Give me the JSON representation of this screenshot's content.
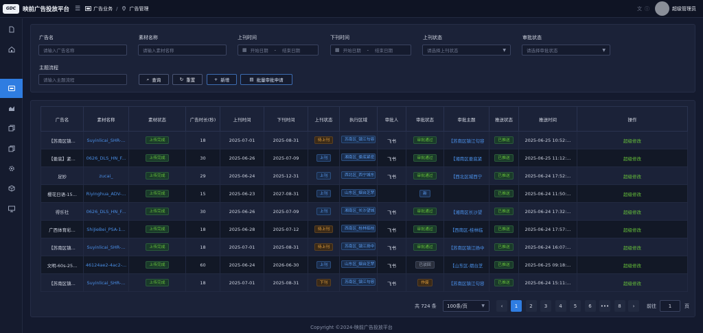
{
  "app": {
    "logo_text": "GDC",
    "title": "映前广告投放平台",
    "breadcrumb": [
      "广告业务",
      "广告管理"
    ],
    "user": "超级管理员"
  },
  "sidebar": {
    "items": [
      {
        "icon": "document-icon",
        "active": false
      },
      {
        "icon": "home-icon",
        "active": false
      },
      {
        "icon": "ad-icon",
        "active": true
      },
      {
        "icon": "chart-icon",
        "active": false
      },
      {
        "icon": "copy-icon",
        "active": false
      },
      {
        "icon": "copy-icon",
        "active": false
      },
      {
        "icon": "gear-icon",
        "active": false
      },
      {
        "icon": "cube-icon",
        "active": false
      },
      {
        "icon": "monitor-icon",
        "active": false
      }
    ]
  },
  "filters": {
    "ad_name": {
      "label": "广告名",
      "placeholder": "请输入广告名称"
    },
    "material_name": {
      "label": "素材名称",
      "placeholder": "请输入素材名称"
    },
    "online_time": {
      "label": "上刊时间",
      "start": "开始日期",
      "sep": "-",
      "end": "结束日期"
    },
    "offline_time": {
      "label": "下刊时间",
      "start": "开始日期",
      "sep": "-",
      "end": "结束日期"
    },
    "online_status": {
      "label": "上刊状态",
      "placeholder": "请选择上刊状态"
    },
    "audit_status": {
      "label": "审批状态",
      "placeholder": "请选择审批状态"
    },
    "subject_flow": {
      "label": "主题流程",
      "placeholder": "请输入主题流程"
    },
    "buttons": {
      "query": "查询",
      "reset": "重置",
      "add": "新增",
      "batch": "批量审批申请"
    }
  },
  "table": {
    "headers": [
      "广告名",
      "素材名称",
      "素材状态",
      "广告时长(秒)",
      "上刊时间",
      "下刊时间",
      "上刊状态",
      "执行区域",
      "审批人",
      "审批状态",
      "审批主题",
      "推送状态",
      "推送时间",
      "操作"
    ],
    "rows": [
      {
        "ad": "【苏南区镇...",
        "material": "Suyinlicai_SHR-...",
        "mstatus": "上传完成",
        "duration": "18",
        "start": "2025-07-01",
        "end": "2025-08-31",
        "ostatus": "待上刊",
        "ostatus_color": "orange",
        "area": "苏南区_镇江句容",
        "approver": "飞书",
        "astatus": "审批通过",
        "astatus_color": "green",
        "subject": "【苏南区镇江句容",
        "pstatus": "已推送",
        "ptime": "2025-06-25 10:52:...",
        "op": "超级修改"
      },
      {
        "ad": "【娄底】紧...",
        "material": "0626_DLS_HN_F...",
        "mstatus": "上传完成",
        "duration": "30",
        "start": "2025-06-26",
        "end": "2025-07-09",
        "ostatus": "上刊",
        "ostatus_color": "blue",
        "area": "湘南区_娄底紧密",
        "approver": "飞书",
        "astatus": "审批通过",
        "astatus_color": "green",
        "subject": "【湘南区娄底紧",
        "pstatus": "已推送",
        "ptime": "2025-06-25 11:12:...",
        "op": "超级修改"
      },
      {
        "ad": "足妙",
        "material": "zucai_",
        "mstatus": "上传完成",
        "duration": "29",
        "start": "2025-06-24",
        "end": "2025-12-31",
        "ostatus": "上刊",
        "ostatus_color": "blue",
        "area": "西北区_西宁城东",
        "approver": "飞书",
        "astatus": "审批通过",
        "astatus_color": "green",
        "subject": "【西北区城西宁",
        "pstatus": "已推送",
        "ptime": "2025-06-24 17:52:...",
        "op": "超级修改"
      },
      {
        "ad": "樱花日语-15...",
        "material": "Riyinghua_ADV-...",
        "mstatus": "上传完成",
        "duration": "15",
        "start": "2025-06-23",
        "end": "2027-08-31",
        "ostatus": "上刊",
        "ostatus_color": "blue",
        "area": "山东区_烟台芝罘",
        "approver": "",
        "astatus": "新",
        "astatus_color": "blue",
        "subject": "",
        "pstatus": "已推送",
        "ptime": "2025-06-24 11:50:...",
        "op": "超级修改"
      },
      {
        "ad": "得乐社",
        "material": "0626_DLS_HN_F...",
        "mstatus": "上传完成",
        "duration": "30",
        "start": "2025-06-26",
        "end": "2025-07-09",
        "ostatus": "上刊",
        "ostatus_color": "blue",
        "area": "湘南区_长沙望城",
        "approver": "飞书",
        "astatus": "审批通过",
        "astatus_color": "green",
        "subject": "【湘南区长沙望",
        "pstatus": "已推送",
        "ptime": "2025-06-24 17:32:...",
        "op": "超级修改"
      },
      {
        "ad": "广西体育彩...",
        "material": "ShiJieBei_PSA-1...",
        "mstatus": "上传完成",
        "duration": "18",
        "start": "2025-06-28",
        "end": "2025-07-12",
        "ostatus": "待上刊",
        "ostatus_color": "orange",
        "area": "西南区_桂林临桂",
        "approver": "飞书",
        "astatus": "审批通过",
        "astatus_color": "green",
        "subject": "【西南区-桂林临",
        "pstatus": "已推送",
        "ptime": "2025-06-24 17:57:...",
        "op": "超级修改"
      },
      {
        "ad": "【苏南区镇...",
        "material": "Suyinlicai_SHR-...",
        "mstatus": "上传完成",
        "duration": "18",
        "start": "2025-07-01",
        "end": "2025-08-31",
        "ostatus": "待上刊",
        "ostatus_color": "orange",
        "area": "苏南区_镇江扬中",
        "approver": "飞书",
        "astatus": "审批通过",
        "astatus_color": "green",
        "subject": "【苏南区镇江扬中",
        "pstatus": "已推送",
        "ptime": "2025-06-24 16:07:...",
        "op": "超级修改"
      },
      {
        "ad": "文明-60s-25...",
        "material": "46124ae2-4ac2-...",
        "mstatus": "上传完成",
        "duration": "60",
        "start": "2025-06-24",
        "end": "2026-06-30",
        "ostatus": "上刊",
        "ostatus_color": "blue",
        "area": "山东区_烟台芝罘",
        "approver": "飞书",
        "astatus": "已驳回",
        "astatus_color": "grey",
        "subject": "【山东区-烟台芝",
        "pstatus": "已推送",
        "ptime": "2025-06-25 09:18:...",
        "op": "超级修改"
      },
      {
        "ad": "【苏南区镇...",
        "material": "Suyinlicai_SHR-...",
        "mstatus": "上传完成",
        "duration": "18",
        "start": "2025-07-01",
        "end": "2025-08-31",
        "ostatus": "下刊",
        "ostatus_color": "orange",
        "area": "苏南区_镇江句容",
        "approver": "飞书",
        "astatus": "作废",
        "astatus_color": "orange",
        "subject": "【苏南区镇江句容",
        "pstatus": "已推送",
        "ptime": "2025-06-24 15:11:...",
        "op": "超级修改"
      }
    ]
  },
  "pagination": {
    "total": "共 724 条",
    "page_size": "100条/页",
    "pages": [
      "1",
      "2",
      "3",
      "4",
      "5",
      "6",
      "•••",
      "8"
    ],
    "current": "1",
    "goto_label": "前往",
    "goto_value": "1",
    "page_suffix": "页"
  },
  "footer": "Copyright ©2024-映前广告投放平台",
  "colors": {
    "accent": "#2f7de1",
    "link": "#4a8fe7",
    "success": "#67c23a",
    "warning": "#e6a23c"
  }
}
